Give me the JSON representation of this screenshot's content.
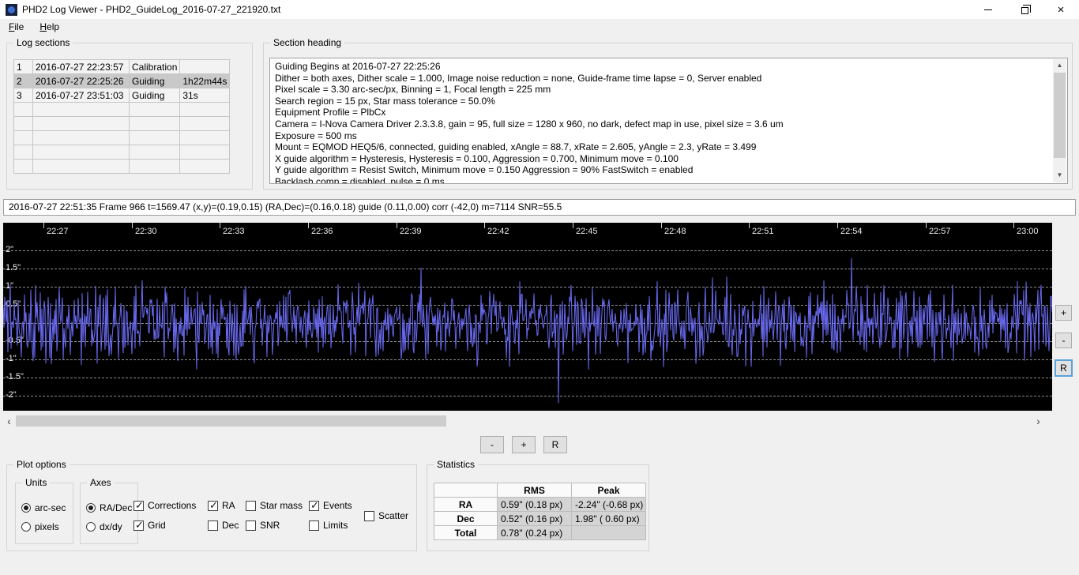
{
  "window": {
    "title": "PHD2 Log Viewer - PHD2_GuideLog_2016-07-27_221920.txt"
  },
  "menu": {
    "file": "File",
    "help": "Help"
  },
  "icons": {
    "close": "×",
    "scroll_up": "▲",
    "scroll_down": "▼",
    "scroll_left": "‹",
    "scroll_right": "›"
  },
  "log_sections": {
    "label": "Log sections",
    "rows": [
      {
        "num": "1",
        "datetime": "2016-07-27 22:23:57",
        "type": "Calibration",
        "duration": "",
        "selected": false
      },
      {
        "num": "2",
        "datetime": "2016-07-27 22:25:26",
        "type": "Guiding",
        "duration": "1h22m44s",
        "selected": true
      },
      {
        "num": "3",
        "datetime": "2016-07-27 23:51:03",
        "type": "Guiding",
        "duration": "31s",
        "selected": false
      }
    ]
  },
  "section_heading": {
    "label": "Section heading",
    "lines": [
      "Guiding Begins at 2016-07-27 22:25:26",
      "Dither = both axes, Dither scale = 1.000, Image noise reduction = none, Guide-frame time lapse = 0, Server enabled",
      "Pixel scale = 3.30 arc-sec/px, Binning = 1, Focal length = 225 mm",
      "Search region = 15 px, Star mass tolerance = 50.0%",
      "Equipment Profile = PlbCx",
      "Camera = I-Nova Camera Driver 2.3.3.8, gain = 95, full size = 1280 x 960, no dark, defect map in use, pixel size = 3.6 um",
      "Exposure = 500 ms",
      "Mount = EQMOD HEQ5/6,  connected, guiding enabled, xAngle = 88.7, xRate = 2.605, yAngle = 2.3, yRate = 3.499",
      "X guide algorithm = Hysteresis, Hysteresis = 0.100, Aggression = 0.700, Minimum move = 0.100",
      "Y guide algorithm = Resist Switch, Minimum move = 0.150 Aggression = 90% FastSwitch = enabled",
      "Backlash comp = disabled, pulse = 0 ms"
    ]
  },
  "status_line": "2016-07-27 22:51:35 Frame 966 t=1569.47 (x,y)=(0.19,0.15) (RA,Dec)=(0.16,0.18) guide (0.11,0.00) corr (-42,0) m=7114 SNR=55.5",
  "graph": {
    "x_labels": [
      "22:27",
      "22:30",
      "22:33",
      "22:36",
      "22:39",
      "22:42",
      "22:45",
      "22:48",
      "22:51",
      "22:54",
      "22:57",
      "23:00"
    ],
    "y_labels": [
      "2\"",
      "1.5\"",
      "1\"",
      "0.5\"",
      "-0.5\"",
      "-1\"",
      "-1.5\"",
      "-2\""
    ],
    "line_color": "#6a6af2",
    "zoom": {
      "plus": "+",
      "minus": "-",
      "reset": "R"
    }
  },
  "h_zoom": {
    "minus": "-",
    "plus": "+",
    "reset": "R"
  },
  "plot_options": {
    "label": "Plot options",
    "units_group": {
      "label": "Units",
      "arc_sec": {
        "label": "arc-sec",
        "selected": true
      },
      "pixels": {
        "label": "pixels",
        "selected": false
      }
    },
    "axes_group": {
      "label": "Axes",
      "ra_dec": {
        "label": "RA/Dec",
        "selected": true
      },
      "dx_dy": {
        "label": "dx/dy",
        "selected": false
      }
    },
    "checkboxes": {
      "corrections": {
        "label": "Corrections",
        "checked": true
      },
      "grid": {
        "label": "Grid",
        "checked": true
      },
      "ra": {
        "label": "RA",
        "checked": true
      },
      "dec": {
        "label": "Dec",
        "checked": false
      },
      "star_mass": {
        "label": "Star mass",
        "checked": false
      },
      "snr": {
        "label": "SNR",
        "checked": false
      },
      "events": {
        "label": "Events",
        "checked": true
      },
      "limits": {
        "label": "Limits",
        "checked": false
      },
      "scatter": {
        "label": "Scatter",
        "checked": false
      }
    }
  },
  "statistics": {
    "label": "Statistics",
    "headers": {
      "rms": "RMS",
      "peak": "Peak"
    },
    "rows": [
      {
        "label": "RA",
        "rms": "0.59\" (0.18 px)",
        "peak": "-2.24\" (-0.68 px)"
      },
      {
        "label": "Dec",
        "rms": "0.52\" (0.16 px)",
        "peak": "1.98\" ( 0.60 px)"
      },
      {
        "label": "Total",
        "rms": "0.78\" (0.24 px)",
        "peak": ""
      }
    ]
  }
}
